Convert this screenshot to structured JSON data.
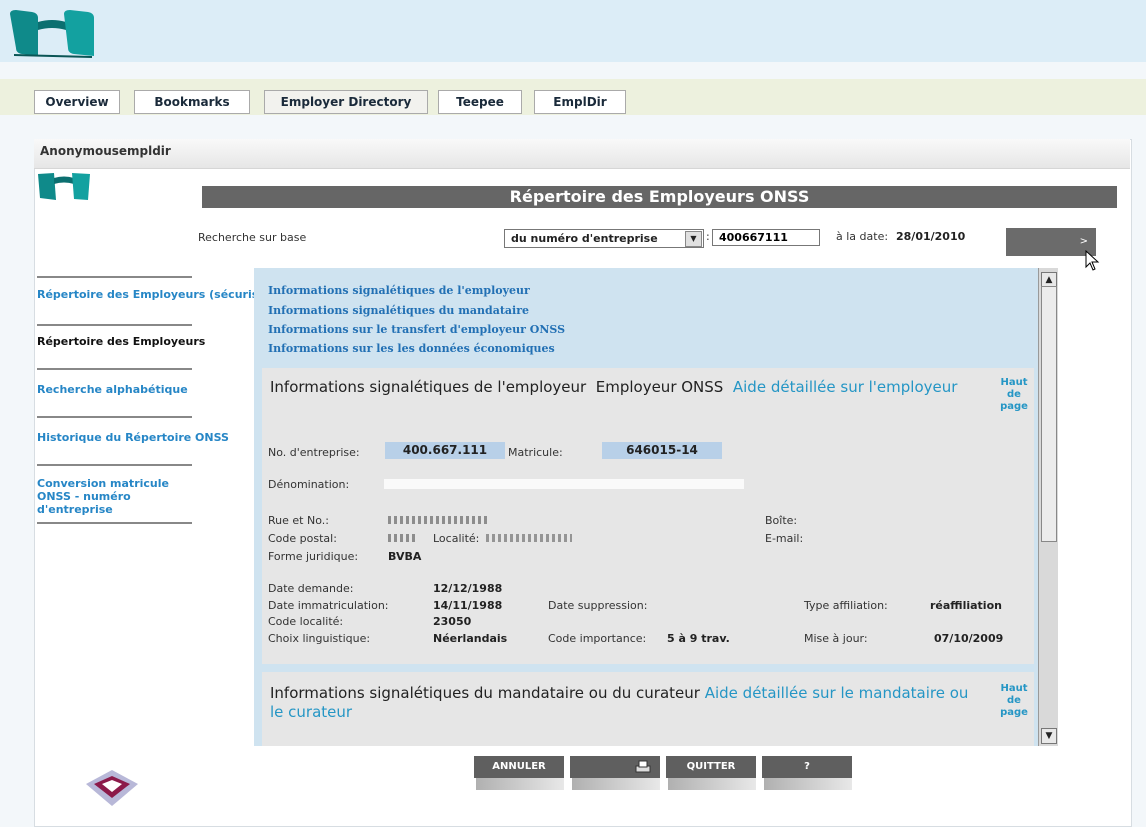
{
  "nav": {
    "tabs": [
      "Overview",
      "Bookmarks",
      "Employer Directory",
      "Teepee",
      "EmplDir"
    ]
  },
  "panel": {
    "title": "Anonymousempldir"
  },
  "banner": {
    "title": "Répertoire des Employeurs ONSS"
  },
  "search": {
    "label": "Recherche sur base",
    "select_value": "du numéro d'entreprise",
    "colon": ":",
    "input_value": "400667111",
    "date_label": "à la date:",
    "date_value": "28/01/2010",
    "go_label": ">"
  },
  "sidebar": {
    "items": [
      {
        "label": "Répertoire des Employeurs (sécurisé)",
        "color": "#2686c6"
      },
      {
        "label": "Répertoire des Employeurs",
        "color": "#111111"
      },
      {
        "label": "Recherche alphabétique",
        "color": "#2686c6"
      },
      {
        "label": "Historique du Répertoire ONSS",
        "color": "#2686c6"
      },
      {
        "label": "Conversion matricule ONSS - numéro d'entreprise",
        "color": "#2686c6"
      }
    ]
  },
  "toc": [
    "Informations signalétiques de l'employeur",
    "Informations signalétiques du mandataire",
    "Informations sur le transfert d'employeur ONSS",
    "Informations sur les les données économiques"
  ],
  "section1": {
    "title": "Informations signalétiques de l'employeur",
    "subtitle": "Employeur ONSS",
    "aide": "Aide détaillée sur l'employeur",
    "haut": "Haut de page",
    "no_entreprise_label": "No. d'entreprise:",
    "no_entreprise_value": "400.667.111",
    "matricule_label": "Matricule:",
    "matricule_value": "646015-14",
    "denomination_label": "Dénomination:",
    "rue_label": "Rue et No.:",
    "boite_label": "Boîte:",
    "code_postal_label": "Code postal:",
    "localite_label": "Localité:",
    "email_label": "E-mail:",
    "forme_label": "Forme juridique:",
    "forme_value": "BVBA",
    "date_demande_label": "Date demande:",
    "date_demande_value": "12/12/1988",
    "date_immat_label": "Date immatriculation:",
    "date_immat_value": "14/11/1988",
    "date_suppr_label": "Date suppression:",
    "type_aff_label": "Type affiliation:",
    "type_aff_value": "réaffiliation",
    "code_loc_label": "Code localité:",
    "code_loc_value": "23050",
    "choix_label": "Choix linguistique:",
    "choix_value": "Néerlandais",
    "code_imp_label": "Code importance:",
    "code_imp_value": "5 à 9 trav.",
    "maj_label": "Mise à jour:",
    "maj_value": "07/10/2009"
  },
  "section2": {
    "title": "Informations signalétiques du mandataire ou du curateur",
    "aide": "Aide détaillée sur le mandataire ou le curateur",
    "haut": "Haut de page"
  },
  "buttons": {
    "annuler": "ANNULER",
    "quitter": "QUITTER",
    "help": "?"
  }
}
